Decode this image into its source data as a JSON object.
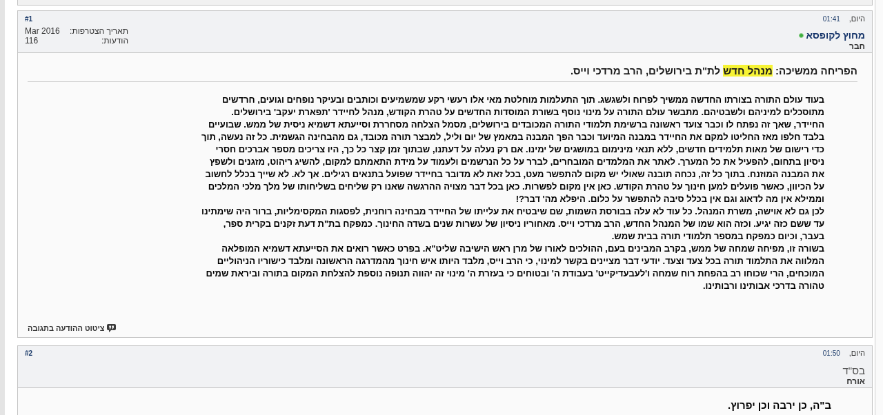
{
  "posts": [
    {
      "number": "#1",
      "date": "היום,",
      "time": "01:41",
      "author": {
        "name": "מחוץ לקופסא",
        "kind": "member",
        "online": true,
        "role": "חבר"
      },
      "stats": [
        {
          "label": "תאריך הצטרפות:",
          "value": "Mar 2016"
        },
        {
          "label": "הודעות:",
          "value": "116"
        }
      ],
      "title": [
        {
          "text": "הפריחה ממשיכה: ",
          "highlighted": false
        },
        {
          "text": "מנהל חדש",
          "highlighted": true
        },
        {
          "text": " לת\"ת בירושלים, הרב מרדכי וייס.",
          "highlighted": false
        }
      ],
      "large_text": false,
      "paragraphs": [
        "בעוד עולם התורה בצורתו החדשה ממשיך לפרוח ולשגשג. תוך התעלמות מוחלטת מאי אלו רעשי רקע שמשמיעים וכותבים ובעיקר נופחים וגועים, חרדשים מתוסכלים למיניהם ולשבטיהם. מתבשר עולם התורה על מינוי נוסף בשורת המוסדות החדשים על טהרת הקודש, מנהל לחיידר 'תפארת יעקב' בירושלים.",
        "החיידר, שאך זה נפתח לו וכבר צועד ראשונה ברשימת תלמודי התורה המכובדים בירושלים, מסמל הצלחה מסחררת וסייעתא דשמיא ניסית של ממש. שבועיים בלבד חלפו מאז החליטו למקם את החיידר במבנה המיועד וכבר הפך המבנה במאמץ של יום וליל, למבצר תורה מכובד, גם מהבחינה הגשמית. כל זה נעשה, תוך כדי רישום של מאות תלמידים חדשים, ללא תנאי מינימום במושגים של ימינו. אם רק נעלה על דעתנו, שבתוך זמן קצר כל כך, היו צריכים מספר אברכים חסרי ניסיון בתחום, להפעיל את כל המערך. לאתר את המלמדים המובחרים, לברר על כל הנרשמים ולעמוד על מידת התאמתם למקום, להשיג ריהוט, מזגנים ולשפץ את המבנה המוזנח. בתוך כל זה, נכחה תובנה שאולי יש מקום להתפשר מעט, בכל זאת לא מדובר בחיידר שפועל בתנאים רגילים. אך לא. לא שייך בכלל לחשוב על הכיוון, כאשר פועלים למען חינוך על טהרת הקודש. כאן אין מקום לפשרות. כאן בכל דבר מצויה ההרגשה שאנו רק שליחים בשליחותו של מלך מלכי המלכים וממילא אין מה לדאוג וגם אין בכלל סיבה להתפשר על כלום. היפלא מה' דבר?!",
        "לכן גם לא אוישה, משרת המנהל. כל עוד לא עלה בבורסת השמות, שם שיבטיח את עלייתו של החיידר מבחינה רוחנית, לפסגות המקסימליות, ברור היה שימתינו עד ששם כזה יגיע. וכזה הוא שמו של המנהל החדש, הרב מרדכי וייס. מאחוריו ניסיון של עשרות שנים בשדה החינוך. כמפקח בת\"ת דעת זקנים בקרית ספר, בעבר, וכיום כמפקח במספר תלמודי תורה בבית שמש.",
        "בשורה זו, מפיחה שמחה של ממש, בקרב המבינים בעם, ההולכים לאורו של מרן ראש הישיבה שליט\"א. בפרט כאשר רואים את הסייעתא דשמיא המופלאה המלווה את התלמוד תורה בכל צעד וצעד. יודעי דבר מציינים בקשר למינוי, כי הרב וייס, מלבד היותו איש חינוך מהמדרגה הראשונה ומלבד כישוריו הניהוליים המוכחים, הרי שכוחו רב בהפחת רוח שמחה ו'לעבעדיקייט' בעבודת ה' ובטוחים כי בעזרת ה' מינוי זה יהווה תנופה נוספת להצלחת המקום בתורה וביראת שמים טהורה בדרכי אבותינו ורבותינו."
      ],
      "quote_button": "ציטוט ההודעה בתגובה"
    },
    {
      "number": "#2",
      "date": "היום,",
      "time": "01:50",
      "author": {
        "name": "בס\"ד",
        "kind": "guest",
        "online": false,
        "role": "אורח"
      },
      "large_text": true,
      "paragraphs": [
        "ב\"ה, כן ירבה וכן יפרוץ."
      ]
    }
  ]
}
